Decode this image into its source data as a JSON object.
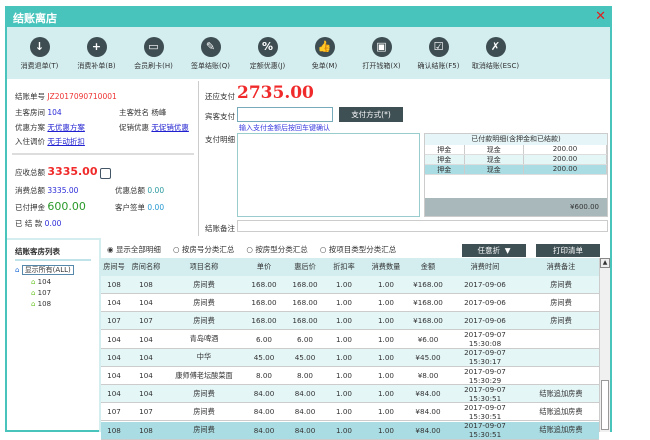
{
  "window": {
    "title": "结账离店",
    "close": "✕"
  },
  "toolbar": [
    {
      "label": "消费退单(T)",
      "icon": "cloud-download-icon",
      "glyph": "↓"
    },
    {
      "label": "消费补单(B)",
      "icon": "cloud-add-icon",
      "glyph": "+"
    },
    {
      "label": "会员刷卡(H)",
      "icon": "card-icon",
      "glyph": "▭"
    },
    {
      "label": "签单结账(Q)",
      "icon": "sign-icon",
      "glyph": "✎"
    },
    {
      "label": "定额优惠(J)",
      "icon": "percent-icon",
      "glyph": "%"
    },
    {
      "label": "免单(M)",
      "icon": "thumb-icon",
      "glyph": "👍"
    },
    {
      "label": "打开钱箱(X)",
      "icon": "wallet-icon",
      "glyph": "▣"
    },
    {
      "label": "确认结账(F5)",
      "icon": "check-icon",
      "glyph": "☑"
    },
    {
      "label": "取消结账(ESC)",
      "icon": "cancel-edit-icon",
      "glyph": "✗"
    }
  ],
  "info": {
    "bill_no_label": "结账单号",
    "bill_no": "JZ2017090710001",
    "room_label": "主客房间",
    "room": "104",
    "guest_label": "主客姓名",
    "guest": "杨峰",
    "discount_label": "优惠方案",
    "discount": "无优惠方案",
    "promo_label": "促销优惠",
    "promo": "无促销优惠",
    "adjust_label": "入住调价",
    "adjust": "无手动折扣",
    "due_label": "应收总额",
    "due": "3335.00",
    "consume_label": "消费总额",
    "consume": "3335.00",
    "offer_label": "优惠总额",
    "offer": "0.00",
    "deposit_label": "已付押金",
    "deposit": "600.00",
    "sign_label": "客户签单",
    "sign": "0.00",
    "settled_label": "已 结 款",
    "settled": "0.00"
  },
  "payment": {
    "should_label": "还应支付",
    "should": "2735.00",
    "guest_pay_label": "宾客支付",
    "guest_pay": "",
    "method_button": "支付方式(*)",
    "hint": "输入支付金额后按回车键确认",
    "detail_label": "支付明细",
    "remark_label": "结账备注",
    "paid_title": "已付款明细(含押金和已结款)",
    "paid_rows": [
      [
        "押金",
        "现金",
        "200.00"
      ],
      [
        "押金",
        "现金",
        "200.00"
      ],
      [
        "押金",
        "现金",
        "200.00"
      ]
    ],
    "paid_total": "¥600.00"
  },
  "tree": {
    "title": "结账客房列表",
    "all": "显示所有(ALL)",
    "rooms": [
      "104",
      "107",
      "108"
    ]
  },
  "table": {
    "radios": [
      "显示全部明细",
      "按房号分类汇总",
      "按房型分类汇总",
      "按项目类型分类汇总"
    ],
    "discount_dropdown": "任意折",
    "print_button": "打印清单",
    "headers": [
      "房间号",
      "房间名称",
      "项目名称",
      "单价",
      "惠后价",
      "折扣率",
      "消费数量",
      "金额",
      "消费时间",
      "消费备注"
    ],
    "rows": [
      [
        "108",
        "108",
        "房间费",
        "168.00",
        "168.00",
        "1.00",
        "1.00",
        "¥168.00",
        "2017-09-06",
        "房间费"
      ],
      [
        "104",
        "104",
        "房间费",
        "168.00",
        "168.00",
        "1.00",
        "1.00",
        "¥168.00",
        "2017-09-06",
        "房间费"
      ],
      [
        "107",
        "107",
        "房间费",
        "168.00",
        "168.00",
        "1.00",
        "1.00",
        "¥168.00",
        "2017-09-06",
        "房间费"
      ],
      [
        "104",
        "104",
        "青岛啤酒",
        "6.00",
        "6.00",
        "1.00",
        "1.00",
        "¥6.00",
        "2017-09-07 15:30:08",
        ""
      ],
      [
        "104",
        "104",
        "中华",
        "45.00",
        "45.00",
        "1.00",
        "1.00",
        "¥45.00",
        "2017-09-07 15:30:17",
        ""
      ],
      [
        "104",
        "104",
        "康师傅老坛酸菜面",
        "8.00",
        "8.00",
        "1.00",
        "1.00",
        "¥8.00",
        "2017-09-07 15:30:29",
        ""
      ],
      [
        "104",
        "104",
        "房间费",
        "84.00",
        "84.00",
        "1.00",
        "1.00",
        "¥84.00",
        "2017-09-07 15:30:51",
        "结账追加房费"
      ],
      [
        "107",
        "107",
        "房间费",
        "84.00",
        "84.00",
        "1.00",
        "1.00",
        "¥84.00",
        "2017-09-07 15:30:51",
        "结账追加房费"
      ],
      [
        "108",
        "108",
        "房间费",
        "84.00",
        "84.00",
        "1.00",
        "1.00",
        "¥84.00",
        "2017-09-07 15:30:51",
        "结账追加房费"
      ]
    ]
  }
}
